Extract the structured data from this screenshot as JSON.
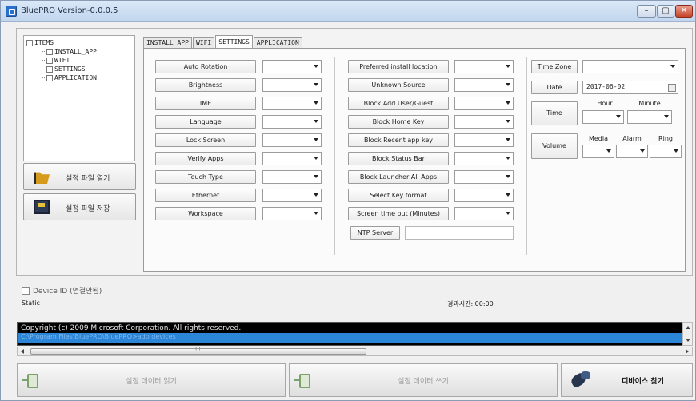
{
  "window": {
    "title": "BluePRO Version-0.0.0.5",
    "min": "–",
    "max": "▢",
    "close": "✕"
  },
  "tree": {
    "root": "ITEMS",
    "children": [
      "INSTALL_APP",
      "WIFI",
      "SETTINGS",
      "APPLICATION"
    ]
  },
  "side_buttons": {
    "open_config": "설정 파일 열기",
    "save_config": "설정 파일 저장"
  },
  "tabs": [
    "INSTALL_APP",
    "WIFI",
    "SETTINGS",
    "APPLICATION"
  ],
  "active_tab": "SETTINGS",
  "settings_col1": [
    "Auto Rotation",
    "Brightness",
    "IME",
    "Language",
    "Lock Screen",
    "Verify Apps",
    "Touch Type",
    "Ethernet",
    "Workspace"
  ],
  "settings_col2": [
    "Preferred install location",
    "Unknown Source",
    "Block Add User/Guest",
    "Block Home Key",
    "Block Recent app key",
    "Block Status Bar",
    "Block Launcher All Apps",
    "Select Key format",
    "Screen time out (Minutes)"
  ],
  "ntp": {
    "label": "NTP Server",
    "value": ""
  },
  "right_panel": {
    "time_zone": "Time Zone",
    "date": "Date",
    "date_value": "2017-06-02",
    "time": "Time",
    "hour": "Hour",
    "minute": "Minute",
    "volume": "Volume",
    "media": "Media",
    "alarm": "Alarm",
    "ring": "Ring"
  },
  "device": {
    "label": "Device ID (연결안됨)",
    "static": "Static",
    "elapsed": "경과시간: 00:00"
  },
  "console": {
    "line1": "Copyright (c) 2009 Microsoft Corporation. All rights reserved.",
    "line2": "C:\\Program Files\\BluePRO\\BluePRO>adb devices"
  },
  "bottom": {
    "read": "설정 데이터 읽기",
    "write": "설정 데이터 쓰기",
    "find": "디바이스 찾기"
  },
  "colors": {
    "console_bg": "#000000",
    "console_sel": "#2b86d8",
    "title_gradient_top": "#dbe8f7"
  }
}
